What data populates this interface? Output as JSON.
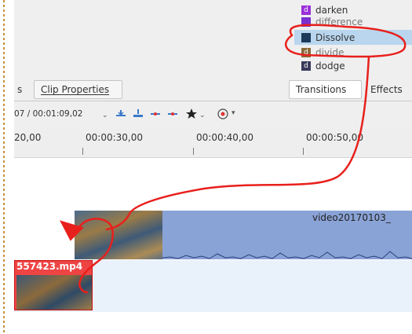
{
  "blend_modes": [
    {
      "label": "darken",
      "icon": "blend-mode-icon",
      "icon_letter": "d",
      "color": "#9b30d9",
      "selected": false
    },
    {
      "label": "difference",
      "icon": "blend-mode-icon",
      "icon_letter": "",
      "color": "#7a2fd0",
      "selected": false
    },
    {
      "label": "Dissolve",
      "icon": "blend-mode-icon",
      "icon_letter": "",
      "color": "#1c3a5a",
      "selected": true
    },
    {
      "label": "divide",
      "icon": "blend-mode-icon",
      "icon_letter": "d",
      "color": "#8a6a3a",
      "selected": false
    },
    {
      "label": "dodge",
      "icon": "blend-mode-icon",
      "icon_letter": "d",
      "color": "#3a3a5c",
      "selected": false
    }
  ],
  "tabs": {
    "partial_left": "s",
    "clip_properties": "Clip Properties",
    "transitions": "Transitions",
    "effects": "Effects"
  },
  "toolbar": {
    "timecode": "07 / 00:01:09,02"
  },
  "ruler": {
    "labels": [
      "20,00",
      "00:00:30,00",
      "00:00:40,00",
      "00:00:50,00"
    ]
  },
  "clips": {
    "main_name": "video20170103_",
    "second_name": "557423.mp4"
  },
  "colors": {
    "accent_selected": "#b9d6ee",
    "clip_blue": "#8aa3d6",
    "clip_red": "#e44444",
    "annotation_red": "#e8201c"
  }
}
